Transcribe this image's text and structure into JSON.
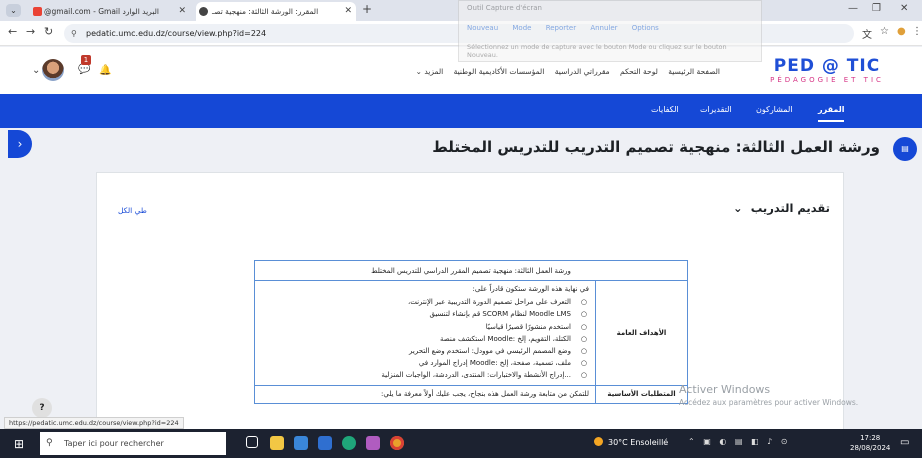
{
  "browser": {
    "tabs": [
      {
        "title": "@gmail.com - Gmail البريد الوارد"
      },
      {
        "title": "المقرر: الورشة الثالثة: منهجية تصـ"
      }
    ],
    "url": "pedatic.umc.edu.dz/course/view.php?id=224",
    "status_url": "https://pedatic.umc.edu.dz/course/view.php?id=224"
  },
  "snipping_tool": {
    "title": "Outil Capture d'écran",
    "buttons": [
      "Nouveau",
      "Mode",
      "Reporter",
      "Annuler",
      "Options"
    ],
    "hint": "Sélectionnez un mode de capture avec le bouton Mode ou cliquez sur le bouton Nouveau."
  },
  "site": {
    "logo": {
      "main": "PED @ TIC",
      "sub": "PÉDAGOGIE ET TIC"
    },
    "notification_count": "1",
    "top_nav": [
      "الصفحة الرئيسية",
      "لوحة التحكم",
      "مقرراتي الدراسية",
      "المؤسسات الأكاديمية الوطنية",
      "المزيد"
    ]
  },
  "course_nav": {
    "items": [
      "المقرر",
      "المشاركون",
      "التقديرات",
      "الكفايات"
    ],
    "active_index": 0
  },
  "page": {
    "title": "ورشة العمل الثالثة: منهجية تصميم التدريب للتدريس المختلط",
    "collapse_all": "طي الكل",
    "section_title": "تقديم التدريب"
  },
  "table": {
    "header": "ورشة العمل الثالثة: منهجية تصميم المقرر الدراسي للتدريس المختلط",
    "rows": [
      {
        "label": "الأهداف العامة",
        "intro": "في نهاية هذه الورشة ستكون قادراً على:",
        "items": [
          "التعرف على مراحل تصميم الدورة التدريبية عبر الإنترنت،",
          "Moodle LMS لنظام SCORM قم بإنشاء لتنسيق",
          "استخدم منشورًا قصيرًا قياسيًا",
          "الكتلة، التقويم، إلخ :Moodle استكشف منصة",
          "وضع المصمم الرئيسي في موودل: استخدم وضع التحرير",
          "ملف، تسمية، صفحة، إلخ :Moodle إدراج الموارد في",
          "...إدراج الأنشطة والاختبارات: المنتدى، الدردشة، الواجبات المنزلية"
        ]
      },
      {
        "label": "المتطلبات الأساسية",
        "intro": "للتمكن من متابعة ورشة العمل هذه بنجاح، يجب عليك أولاً معرفة ما يلي:",
        "items": []
      }
    ]
  },
  "watermark": {
    "line1": "Activer Windows",
    "line2": "Accédez aux paramètres pour activer Windows."
  },
  "taskbar": {
    "search_placeholder": "Taper ici pour rechercher",
    "weather": "30°C Ensoleillé",
    "time": "17:28",
    "date": "28/08/2024"
  },
  "colors": {
    "brand_blue": "#1548d6",
    "logo_pink": "#d63384",
    "table_border": "#5a8fd6"
  }
}
